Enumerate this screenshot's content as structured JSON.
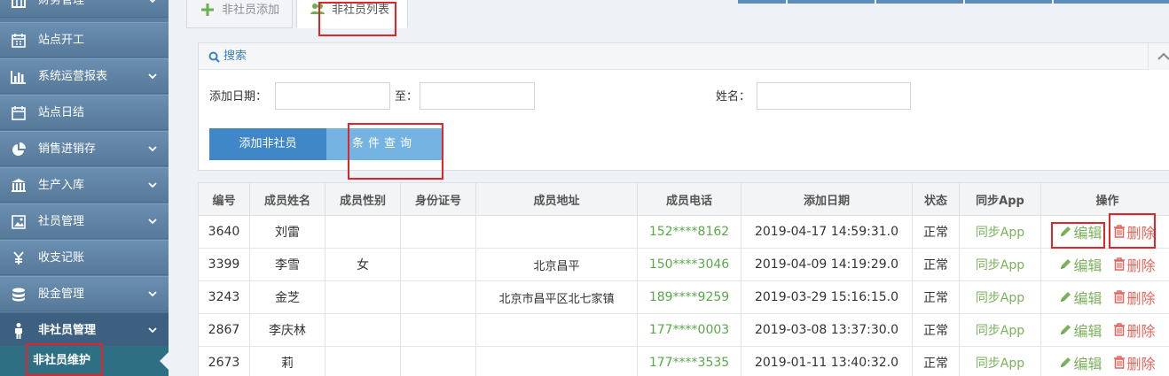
{
  "sidebar": {
    "items": [
      {
        "label": "财务管理",
        "icon": "calculator-icon"
      },
      {
        "label": "站点开工",
        "icon": "calendar-icon"
      },
      {
        "label": "系统运营报表",
        "icon": "bar-chart-icon"
      },
      {
        "label": "站点日结",
        "icon": "calendar-icon"
      },
      {
        "label": "销售进销存",
        "icon": "pie-chart-icon"
      },
      {
        "label": "生产入库",
        "icon": "bank-icon"
      },
      {
        "label": "社员管理",
        "icon": "picture-icon"
      },
      {
        "label": "收支记账",
        "icon": "yen-icon"
      },
      {
        "label": "股金管理",
        "icon": "database-icon"
      },
      {
        "label": "非社员管理",
        "icon": "person-icon"
      }
    ],
    "subitem": "非社员维护"
  },
  "tabs": [
    "非社员添加",
    "非社员列表"
  ],
  "search": {
    "title": "搜索",
    "date_label": "添加日期：",
    "to_label": "至：",
    "name_label": "姓名：",
    "add_button": "添加非社员",
    "query_button": "条件查询"
  },
  "table": {
    "headers": [
      "编号",
      "成员姓名",
      "成员性别",
      "身份证号",
      "成员地址",
      "成员电话",
      "添加日期",
      "状态",
      "同步App",
      "操作"
    ],
    "edit_label": "编辑",
    "delete_label": "删除",
    "rows": [
      {
        "id": "3640",
        "name": "刘雷",
        "gender": "",
        "idno": "",
        "address": "",
        "phone": "152****8162",
        "date": "2019-04-17 14:59:31.0",
        "status": "正常",
        "sync": "同步App"
      },
      {
        "id": "3399",
        "name": "李雪",
        "gender": "女",
        "idno": "",
        "address": "北京昌平",
        "phone": "150****3046",
        "date": "2019-04-09 14:19:29.0",
        "status": "正常",
        "sync": "同步App"
      },
      {
        "id": "3243",
        "name": "金芝",
        "gender": "",
        "idno": "",
        "address": "北京市昌平区北七家镇",
        "phone": "189****9259",
        "date": "2019-03-29 15:16:15.0",
        "status": "正常",
        "sync": "同步App"
      },
      {
        "id": "2867",
        "name": "李庆林",
        "gender": "",
        "idno": "",
        "address": "",
        "phone": "177****0003",
        "date": "2019-03-08 13:37:30.0",
        "status": "正常",
        "sync": "同步App"
      },
      {
        "id": "2673",
        "name": "莉",
        "gender": "",
        "idno": "",
        "address": "",
        "phone": "177****3535",
        "date": "2019-01-11 13:40:32.0",
        "status": "正常",
        "sync": "同步App"
      }
    ]
  },
  "colors": {
    "sidebar": "#5b7fa0",
    "accent": "#3f87c6",
    "phone": "#59a84a",
    "delete": "#e3675d",
    "highlight": "#e0252a"
  }
}
